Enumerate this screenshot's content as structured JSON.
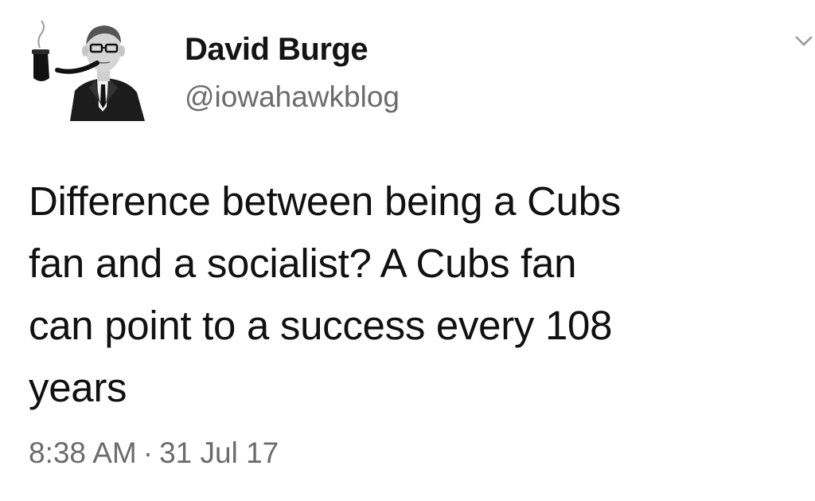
{
  "tweet": {
    "author": {
      "display_name": "David Burge",
      "handle": "@iowahawkblog",
      "avatar_icon": "pipe-smoking-man-avatar"
    },
    "text_lines": [
      "Difference between being a Cubs",
      "fan and a socialist? A Cubs fan",
      "can point to a success every 108",
      "years"
    ],
    "time": "8:38 AM",
    "separator": "·",
    "date": "31 Jul 17",
    "menu_icon": "chevron-down-icon"
  },
  "colors": {
    "text": "#111111",
    "secondary_text": "#6b6b6b",
    "background": "#ffffff"
  }
}
